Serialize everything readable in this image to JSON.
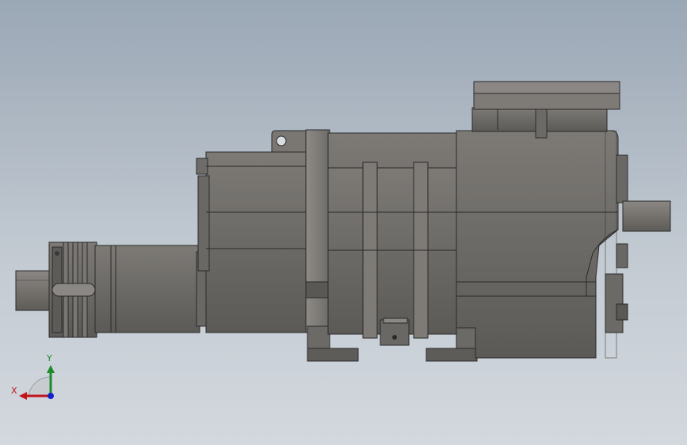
{
  "viewport": {
    "background_top": "#9aa7b5",
    "background_bottom": "#d3d8de"
  },
  "model": {
    "body_color": "#6f6d69",
    "body_light": "#8a8784",
    "body_dark": "#55534f",
    "edge_color": "#2a2a2a"
  },
  "triad": {
    "x_label": "X",
    "y_label": "Y",
    "x_color": "#c0151b",
    "y_color": "#1e8a2a",
    "z_color": "#1420c8"
  }
}
